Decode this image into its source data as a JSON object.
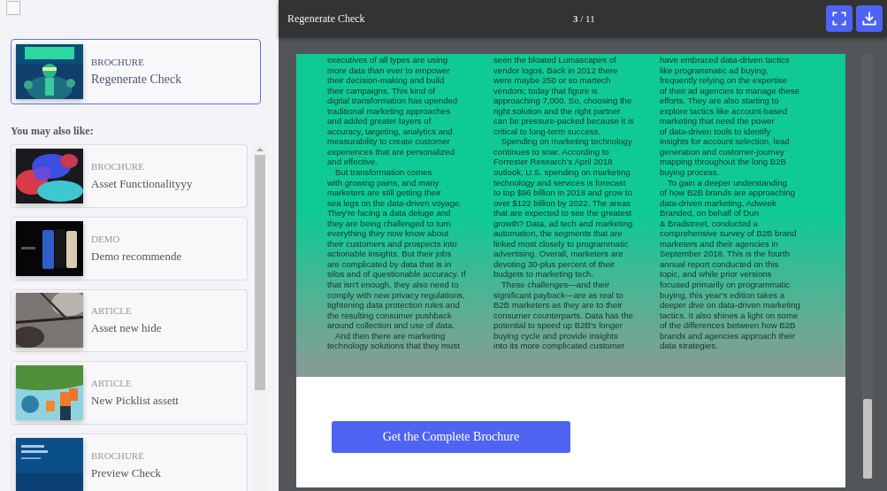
{
  "sidebar": {
    "select_all": {
      "checked": false
    },
    "current": {
      "type": "BROCHURE",
      "title": "Regenerate Check",
      "selected": true
    },
    "recommendations_heading": "You may also like:",
    "recommendations": [
      {
        "type": "BROCHURE",
        "title": "Asset Functionalityyy",
        "selected": false
      },
      {
        "type": "DEMO",
        "title": "Demo recommende",
        "selected": false
      },
      {
        "type": "ARTICLE",
        "title": "Asset new hide",
        "selected": false
      },
      {
        "type": "ARTICLE",
        "title": "New Picklist assett",
        "selected": false
      },
      {
        "type": "BROCHURE",
        "title": "Preview Check",
        "selected": false
      }
    ]
  },
  "viewer": {
    "title": "Regenerate Check",
    "page_indicator": "**3** / 11",
    "document": {
      "columns": [
        [
          {
            "indent": false,
            "lines": [
              "executives of all types are using",
              "more data than ever to empower",
              "their decision-making and build",
              "their campaigns. This kind of",
              "digital transformation has upended",
              "traditional marketing approaches",
              "and added greater layers of",
              "accuracy, targeting, analytics and",
              "measurability to create customer",
              "experiences that are personalized",
              "and effective."
            ]
          },
          {
            "indent": true,
            "lines": [
              "But transformation comes",
              "with growing pains, and many",
              "marketers are still getting their",
              "sea legs on the data-driven voyage.",
              "They're facing a data deluge and",
              "they are being challenged to turn",
              "everything they now know about",
              "their customers and prospects into",
              "actionable insights. But their jobs",
              "are complicated by data that is in",
              "silos and of questionable accuracy. If",
              "that isn't enough, they also need to",
              "comply with new privacy regulations,",
              "tightening data protection rules and",
              "the resulting consumer pushback",
              "around collection and use of data."
            ]
          },
          {
            "indent": true,
            "lines": [
              "And then there are marketing",
              "technology solutions that they must"
            ]
          }
        ],
        [
          {
            "indent": false,
            "lines": [
              "seen the bloated Lumascapes of",
              "vendor logos. Back in 2012 there",
              "were maybe 250 or so martech",
              "vendors; today that figure is",
              "approaching 7,000. So, choosing the",
              "right solution and the right partner",
              "can be pressure-packed because it is",
              "critical to long-term success."
            ]
          },
          {
            "indent": true,
            "lines": [
              "Spending on marketing technology",
              "continues to soar. According to",
              "Forrester Research's April 2018",
              "outlook, U.S. spending on marketing",
              "technology and services is forecast",
              "to top $96 billion in 2018 and grow to",
              "over $122 billion by 2022. The areas",
              "that are expected to see the greatest",
              "growth? Data, ad tech and marketing",
              "automation, the segments that are",
              "linked most closely to programmatic",
              "advertising. Overall, marketers are",
              "devoting 30-plus percent of their",
              "budgets to marketing tech."
            ]
          },
          {
            "indent": true,
            "lines": [
              "These challenges—and their",
              "significant payback—are as real to",
              "B2B marketers as they are to their",
              "consumer counterparts. Data has the",
              "potential to speed up B2B's longer",
              "buying cycle and provide insights",
              "into its more complicated customer"
            ]
          }
        ],
        [
          {
            "indent": false,
            "lines": [
              "have embraced data-driven tactics",
              "like programmatic ad buying,",
              "frequently relying on the expertise",
              "of their ad agencies to manage these",
              "efforts. They are also starting to",
              "explore tactics like account-based",
              "marketing that need the power",
              "of data-driven tools to identify",
              "insights for account selection, lead",
              "generation and customer-journey",
              "mapping throughout the long B2B",
              "buying process."
            ]
          },
          {
            "indent": true,
            "lines": [
              "To gain a deeper understanding",
              "of how B2B brands are approaching",
              "data-driven marketing, Adweek",
              "Branded, on behalf of Dun",
              "& Bradstreet, conducted a",
              "comprehensive survey of B2B brand",
              "marketers and their agencies in",
              "September 2018. This is the fourth",
              "annual report conducted on this",
              "topic, and while prior versions",
              "focused primarily on programmatic",
              "buying, this year's edition takes a",
              "deeper dive on data-driven marketing",
              "tactics. It also shines a light on some",
              "of the differences between how B2B",
              "brands and agencies approach their",
              "data strategies."
            ]
          }
        ]
      ]
    },
    "cta": "Get the Complete Brochure"
  }
}
